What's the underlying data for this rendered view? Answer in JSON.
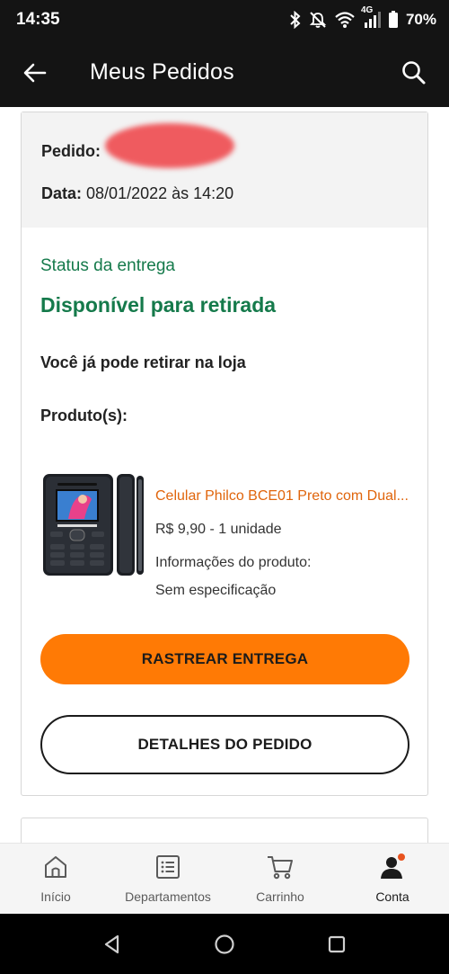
{
  "status_bar": {
    "time": "14:35",
    "network": "4G",
    "battery": "70%",
    "icons": [
      "bluetooth-icon",
      "mute-icon",
      "wifi-icon",
      "signal-icon",
      "battery-icon"
    ]
  },
  "app_bar": {
    "title": "Meus Pedidos",
    "icons": [
      "back-arrow-icon",
      "search-icon"
    ]
  },
  "order": {
    "number_label": "Pedido:",
    "date_label": "Data:",
    "date_value": "08/01/2022 às 14:20",
    "delivery_status_label": "Status da entrega",
    "delivery_status_value": "Disponível para retirada",
    "pickup_message": "Você já pode retirar na loja",
    "products_label": "Produto(s):",
    "products": [
      {
        "name": "Celular Philco BCE01 Preto com Dual...",
        "price_qty": "R$ 9,90 - 1 unidade",
        "info_label": "Informações do produto:",
        "spec": "Sem especificação"
      }
    ],
    "track_button": "RASTREAR ENTREGA",
    "details_button": "DETALHES DO PEDIDO"
  },
  "bottom_nav": {
    "items": [
      {
        "label": "Início",
        "icon": "home-icon"
      },
      {
        "label": "Departamentos",
        "icon": "list-icon"
      },
      {
        "label": "Carrinho",
        "icon": "cart-icon"
      },
      {
        "label": "Conta",
        "icon": "account-icon"
      }
    ],
    "active_index": 3
  },
  "colors": {
    "accent_orange": "#ff7a05",
    "status_green": "#157a4b",
    "product_link": "#e0650c",
    "dark_bar": "#141414"
  }
}
